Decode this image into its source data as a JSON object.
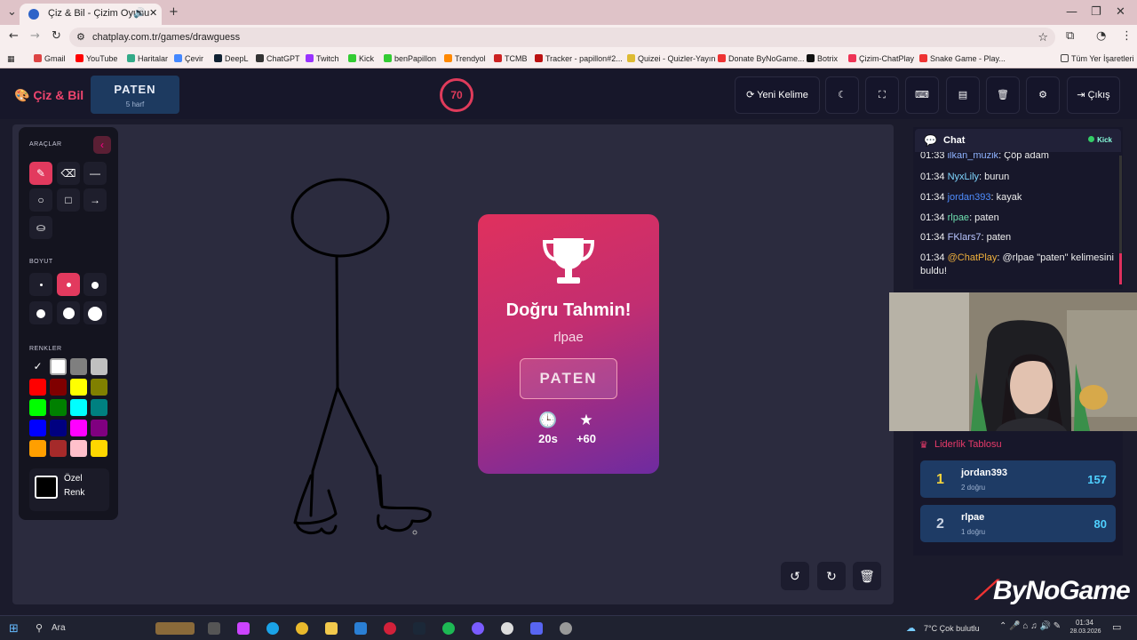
{
  "browser": {
    "tab_title": "Çiz & Bil - Çizim Oyunu",
    "url": "chatplay.com.tr/games/drawguess",
    "bookmarks": [
      "Gmail",
      "YouTube",
      "Haritalar",
      "Çevir",
      "DeepL",
      "ChatGPT",
      "Twitch",
      "Kick",
      "benPapillon",
      "Trendyol",
      "TCMB",
      "Tracker - papillon#2...",
      "Quizei - Quizler-Yayın",
      "Donate ByNoGame...",
      "Botrix",
      "Çizim-ChatPlay",
      "Snake Game - Play..."
    ],
    "all_bookmarks": "Tüm Yer İşaretleri"
  },
  "header": {
    "logo": "Çiz & Bil",
    "word": "PATEN",
    "word_hint": "5 harf",
    "timer": "70",
    "new_word": "Yeni Kelime",
    "exit": "Çıkış"
  },
  "toolbox": {
    "tools_label": "ARAÇLAR",
    "size_label": "BOYUT",
    "colors_label": "RENKLER",
    "custom_line1": "Özel",
    "custom_line2": "Renk",
    "colors": [
      "#000000",
      "#ffffff",
      "#7f7f7f",
      "#c0c0c0",
      "#ff0000",
      "#800000",
      "#ffff00",
      "#808000",
      "#00ff00",
      "#008000",
      "#00ffff",
      "#008080",
      "#0000ff",
      "#000080",
      "#ff00ff",
      "#800080",
      "#ff9f00",
      "#a52a2a",
      "#ffc0cb",
      "#ffd700"
    ]
  },
  "modal": {
    "title": "Doğru Tahmin!",
    "user": "rlpae",
    "word": "PATEN",
    "time": "20s",
    "points": "+60"
  },
  "chat": {
    "title": "Chat",
    "platform": "Kick",
    "messages": [
      {
        "time": "01:33",
        "user": "ilkan_muzik",
        "text": ": Çöp adam",
        "color": "#8fb3ff"
      },
      {
        "time": "01:34",
        "user": "NyxLily",
        "text": ": burun",
        "color": "#7fd6ff"
      },
      {
        "time": "01:34",
        "user": "jordan393",
        "text": ": kayak",
        "color": "#4f8dff"
      },
      {
        "time": "01:34",
        "user": "rlpae",
        "text": ": paten",
        "color": "#6fe0b0"
      },
      {
        "time": "01:34",
        "user": "FKlars7",
        "text": ": paten",
        "color": "#b9c6ff"
      },
      {
        "time": "01:34",
        "user": "@ChatPlay",
        "text": ": @rlpae \"paten\" kelimesini",
        "color": "#f0b03c"
      }
    ],
    "wrap": "buldu!"
  },
  "leaderboard": {
    "title": "Liderlik Tablosu",
    "rows": [
      {
        "rank": "1",
        "name": "jordan393",
        "sub": "2 doğru",
        "score": "157"
      },
      {
        "rank": "2",
        "name": "rlpae",
        "sub": "1 doğru",
        "score": "80"
      }
    ]
  },
  "overlay": {
    "brand": "ByNoGame"
  },
  "taskbar": {
    "search": "Ara",
    "weather": "7°C  Çok bulutlu",
    "time": "01:34",
    "date": "28.03.2026"
  }
}
